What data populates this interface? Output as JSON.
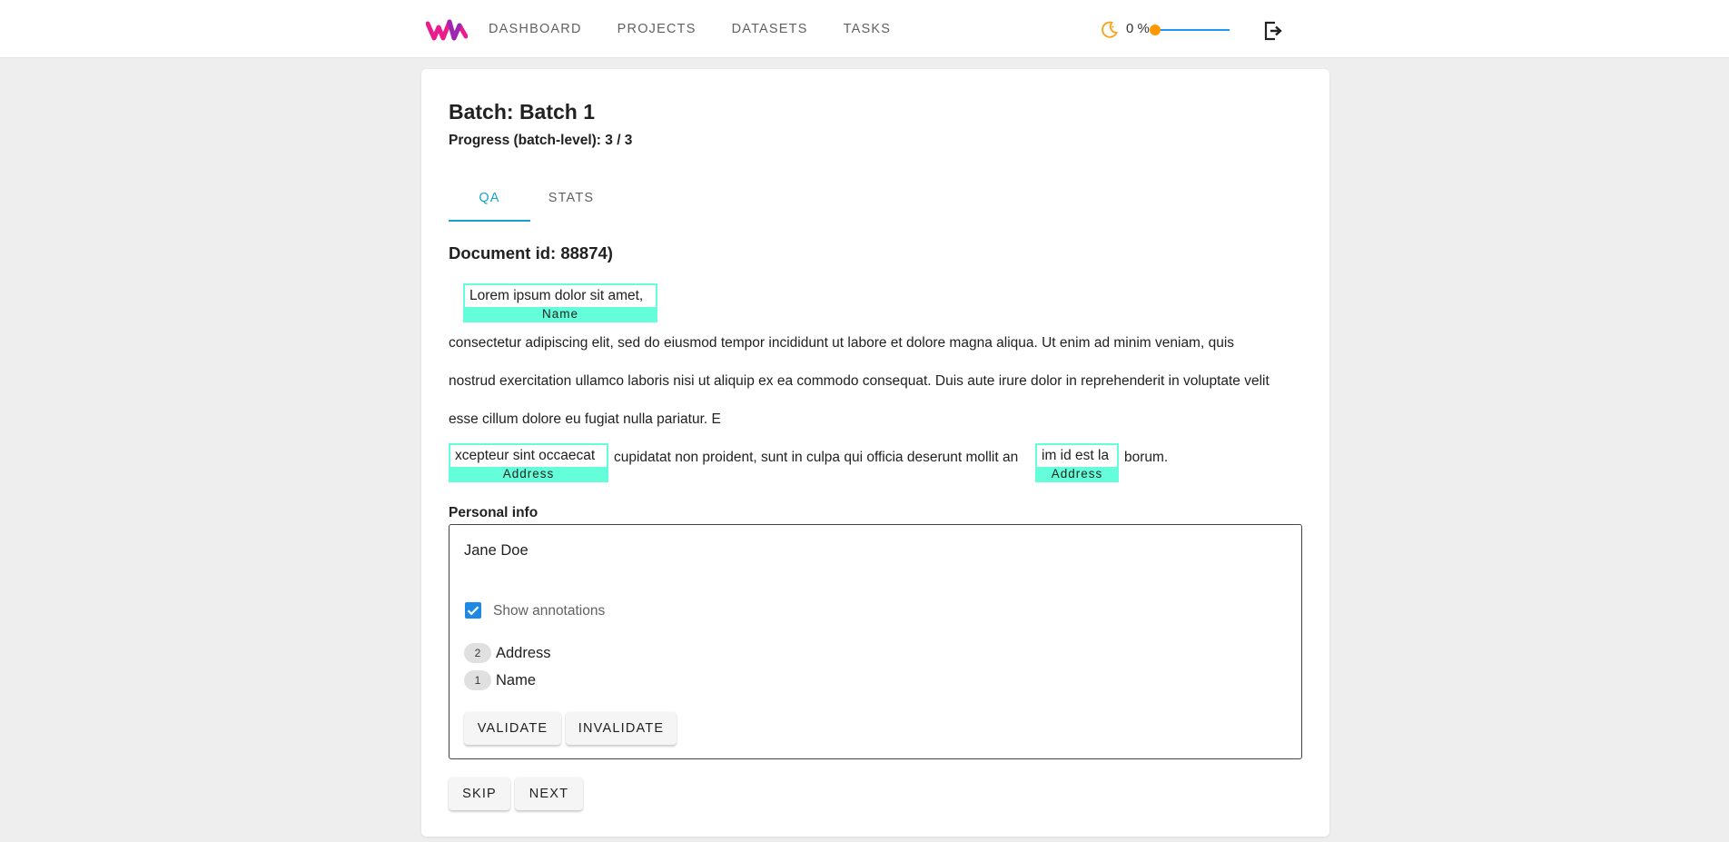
{
  "nav": {
    "items": [
      "DASHBOARD",
      "PROJECTS",
      "DATASETS",
      "TASKS"
    ],
    "percent_label": "0 %",
    "slider_value": 0,
    "icons": {
      "logo": "logo-icon",
      "theme": "moon-icon",
      "logout": "logout-icon"
    },
    "colors": {
      "logo": "#e91e8c",
      "theme_icon": "#f5a623",
      "slider_track": "#2196f3",
      "slider_thumb": "#ff9800"
    }
  },
  "batch": {
    "title": "Batch: Batch 1",
    "progress": "Progress (batch-level): 3 / 3",
    "tabs": [
      {
        "label": "QA",
        "active": true
      },
      {
        "label": "STATS",
        "active": false
      }
    ]
  },
  "document": {
    "id_label": "Document id: 88874)",
    "annotations": [
      {
        "text": "Lorem ipsum dolor sit amet,",
        "label": "Name"
      },
      {
        "text": "xcepteur sint occaecat",
        "label": "Address"
      },
      {
        "text": "im id est la",
        "label": "Address"
      }
    ],
    "lines": [
      "consectetur adipiscing elit, sed do eiusmod tempor incididunt ut labore et dolore magna aliqua. Ut enim ad minim veniam, quis",
      "nostrud exercitation ullamco laboris nisi ut aliquip ex ea commodo consequat. Duis aute irure dolor in reprehenderit in voluptate velit",
      "esse cillum dolore eu fugiat nulla pariatur. E"
    ],
    "segment_middle": "cupidatat non proident, sunt in culpa qui officia deserunt mollit an",
    "segment_end": "borum.",
    "annotation_color": "#64ffda"
  },
  "personal_info": {
    "label": "Personal info",
    "name": "Jane Doe",
    "show_annotations_label": "Show annotations",
    "show_annotations_checked": true,
    "counts": [
      {
        "count": "2",
        "name": "Address"
      },
      {
        "count": "1",
        "name": "Name"
      }
    ],
    "validate_label": "VALIDATE",
    "invalidate_label": "INVALIDATE"
  },
  "footer": {
    "skip_label": "SKIP",
    "next_label": "NEXT"
  },
  "accent_color": "#17a2c8"
}
